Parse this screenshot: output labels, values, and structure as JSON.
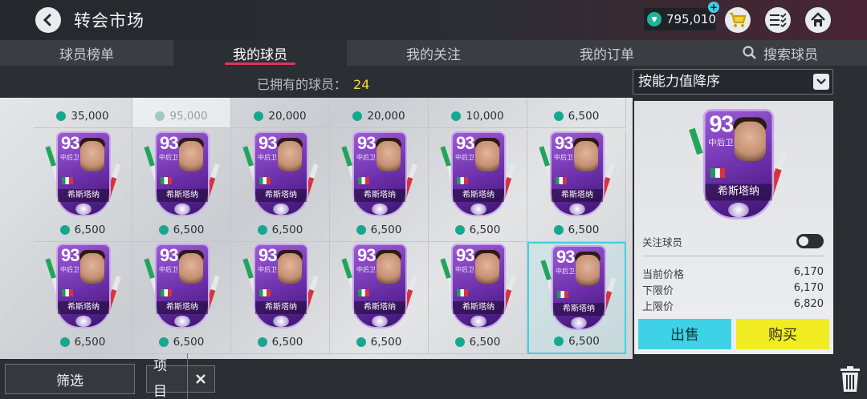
{
  "header": {
    "title": "转会市场",
    "coins": "795,010",
    "coin_plus": "+"
  },
  "tabs": [
    {
      "label": "球员榜单",
      "active": false
    },
    {
      "label": "我的球员",
      "active": true
    },
    {
      "label": "我的关注",
      "active": false
    },
    {
      "label": "我的订单",
      "active": false
    },
    {
      "label": "搜索球员",
      "active": false
    }
  ],
  "subbar": {
    "owned_label": "已拥有的球员：",
    "owned_count": "24",
    "sort_value": "按能力值降序"
  },
  "card": {
    "rating": "93",
    "position": "中后卫",
    "name": "希斯塔纳"
  },
  "grid": {
    "top_row_prices": [
      "35,000",
      "95,000",
      "20,000",
      "20,000",
      "10,000",
      "6,500"
    ],
    "row2_prices": [
      "6,500",
      "6,500",
      "6,500",
      "6,500",
      "6,500",
      "6,500"
    ],
    "row3_prices": [
      "6,500",
      "6,500",
      "6,500",
      "6,500",
      "6,500",
      "6,500"
    ],
    "selected_index": 5
  },
  "detail": {
    "follow_label": "关注球员",
    "current_price_label": "当前价格",
    "current_price": "6,170",
    "min_price_label": "下限价",
    "min_price": "6,170",
    "max_price_label": "上限价",
    "max_price": "6,820",
    "sell_label": "出售",
    "buy_label": "购买"
  },
  "bottom": {
    "filter_label": "筛选",
    "chip_label": "项目"
  },
  "colors": {
    "accent_cyan": "#3fd2e6",
    "accent_yellow": "#f2ec23",
    "tab_underline": "#e0345a",
    "coin_green": "#16a88f",
    "card_purple": "#6a2ea8"
  }
}
